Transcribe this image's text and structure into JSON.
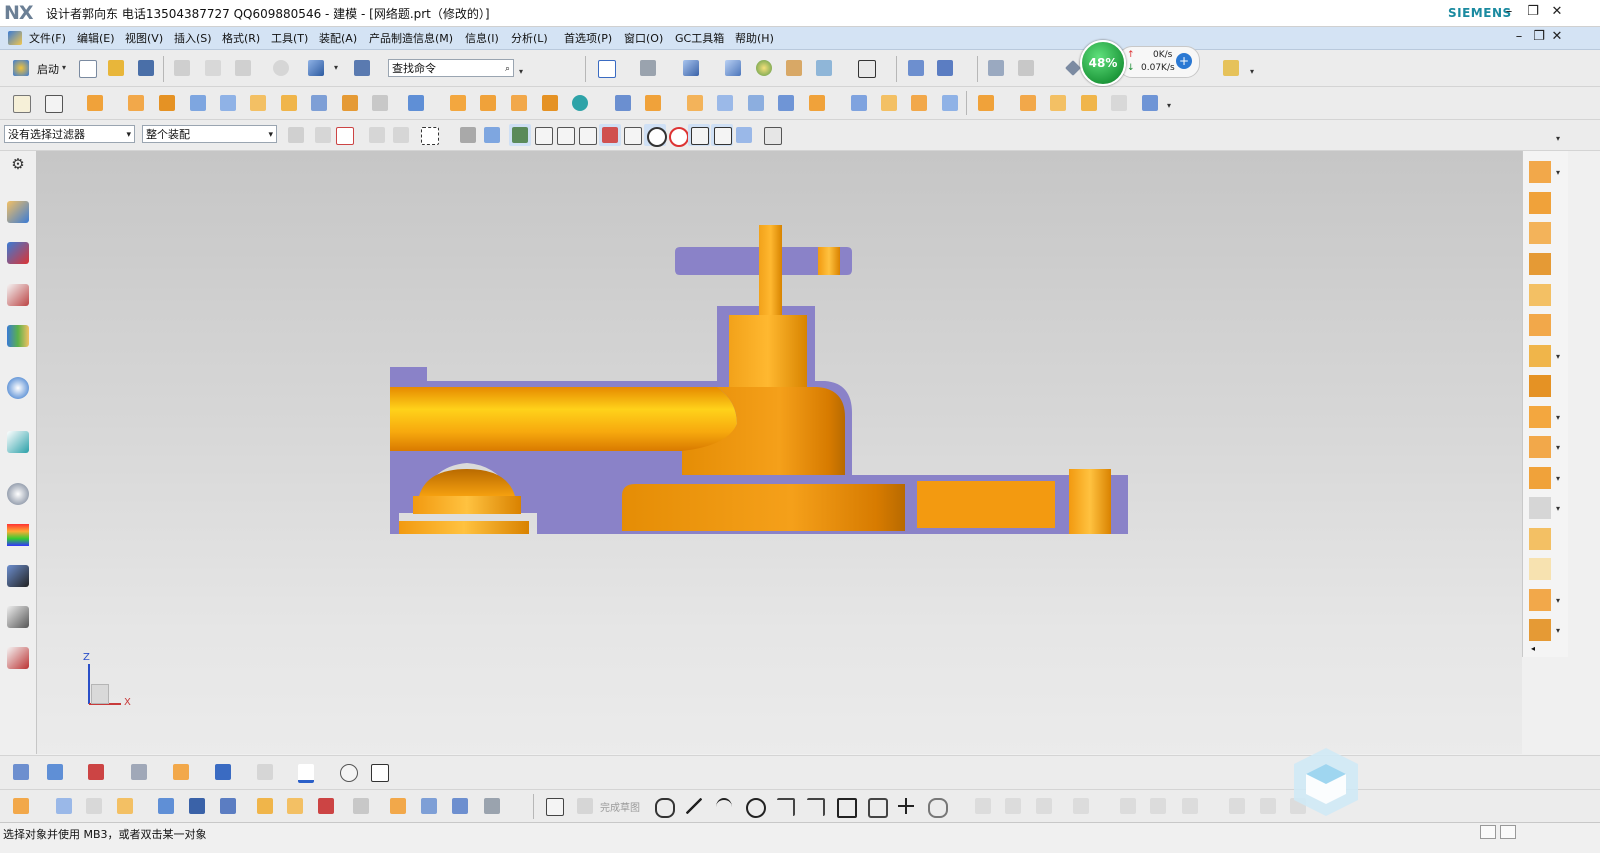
{
  "window": {
    "logo": "NX",
    "title": "设计者郭向东  电话13504387727  QQ609880546 - 建模 - [网络题.prt（修改的）]",
    "brand": "SIEMENS"
  },
  "menu": [
    "文件(F)",
    "编辑(E)",
    "视图(V)",
    "插入(S)",
    "格式(R)",
    "工具(T)",
    "装配(A)",
    "产品制造信息(M)",
    "信息(I)",
    "分析(L)",
    "首选项(P)",
    "窗口(O)",
    "GC工具箱",
    "帮助(H)"
  ],
  "toolbar1": {
    "start_label": "启动",
    "search_placeholder": "查找命令"
  },
  "netmeter": {
    "percent": "48%",
    "upload": "0K/s",
    "download": "0.07K/s"
  },
  "selection": {
    "filter": "没有选择过滤器",
    "scope": "整个装配"
  },
  "sketch_toolbar": {
    "finish_sketch": "完成草图"
  },
  "triad": {
    "z": "Z",
    "x": "X"
  },
  "status": {
    "prompt": "选择对象并使用 MB3，或者双击某一对象"
  },
  "colors": {
    "part_orange": "#f39a10",
    "section_purple": "#8a82c8",
    "menu_bg": "#d4e3f4"
  }
}
